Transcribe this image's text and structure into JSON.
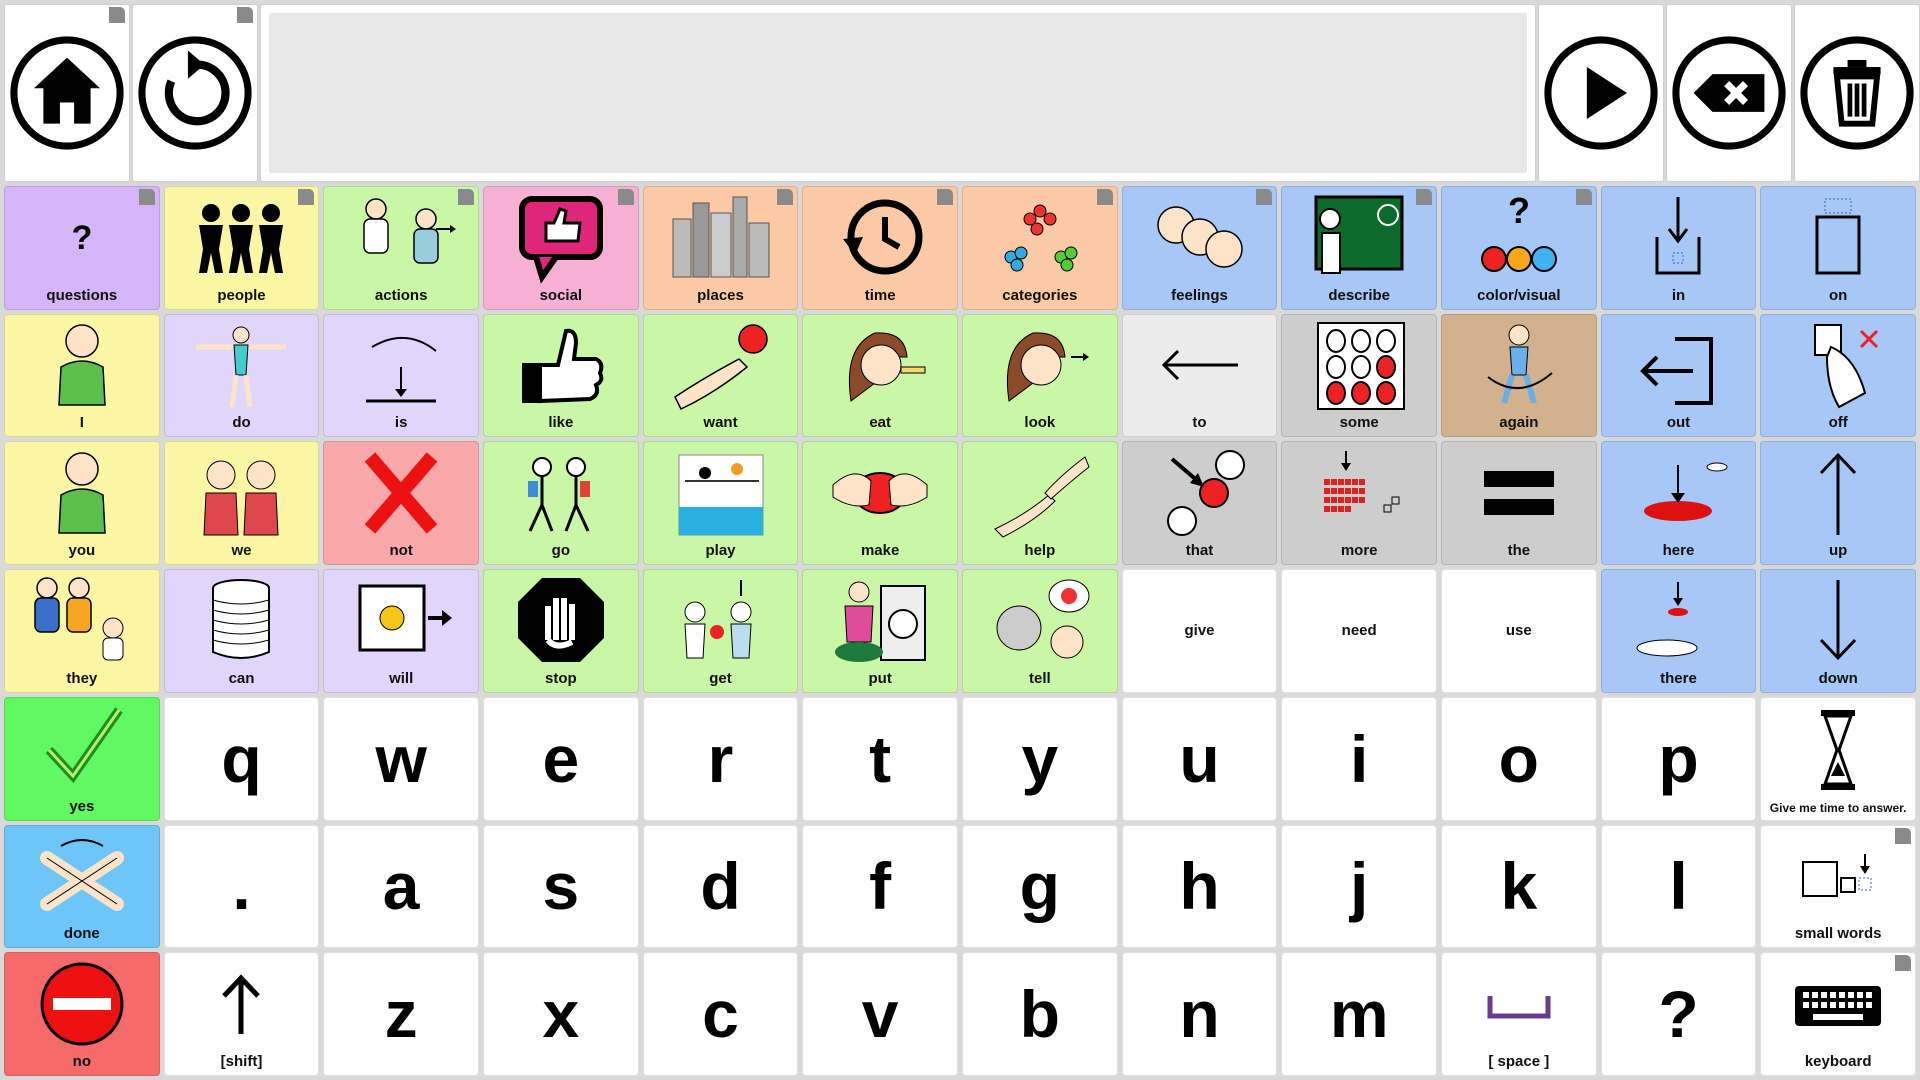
{
  "toolbar": {
    "home_icon": "home-icon",
    "undo_icon": "undo-icon",
    "message": "",
    "speak_icon": "play-icon",
    "backspace_icon": "backspace-icon",
    "clear_icon": "trash-icon"
  },
  "rows": [
    [
      {
        "label": "questions",
        "color": "purple",
        "icon": "question-icon"
      },
      {
        "label": "people",
        "color": "yellow",
        "icon": "people-icon"
      },
      {
        "label": "actions",
        "color": "lgreen",
        "icon": "actions-icon"
      },
      {
        "label": "social",
        "color": "pink",
        "icon": "social-icon"
      },
      {
        "label": "places",
        "color": "peach",
        "icon": "places-icon"
      },
      {
        "label": "time",
        "color": "peach",
        "icon": "clock-icon"
      },
      {
        "label": "categories",
        "color": "peach",
        "icon": "categories-icon"
      },
      {
        "label": "feelings",
        "color": "blue",
        "icon": "feelings-icon"
      },
      {
        "label": "describe",
        "color": "blue",
        "icon": "describe-icon"
      },
      {
        "label": "color/visual",
        "color": "blue",
        "icon": "color-icon"
      },
      {
        "label": "in",
        "color": "blue",
        "icon": "in-icon"
      },
      {
        "label": "on",
        "color": "blue",
        "icon": "on-icon"
      }
    ],
    [
      {
        "label": "I",
        "color": "yellow",
        "icon": "person-icon"
      },
      {
        "label": "do",
        "color": "lav",
        "icon": "do-icon"
      },
      {
        "label": "is",
        "color": "lav",
        "icon": "is-icon"
      },
      {
        "label": "like",
        "color": "lgreen",
        "icon": "thumbs-up-icon"
      },
      {
        "label": "want",
        "color": "lgreen",
        "icon": "want-icon"
      },
      {
        "label": "eat",
        "color": "lgreen",
        "icon": "eat-icon"
      },
      {
        "label": "look",
        "color": "lgreen",
        "icon": "look-icon"
      },
      {
        "label": "to",
        "color": "lgray",
        "icon": "arrow-left-icon"
      },
      {
        "label": "some",
        "color": "gray",
        "icon": "some-icon"
      },
      {
        "label": "again",
        "color": "tan",
        "icon": "again-icon"
      },
      {
        "label": "out",
        "color": "blue",
        "icon": "out-icon"
      },
      {
        "label": "off",
        "color": "blue",
        "icon": "off-icon"
      }
    ],
    [
      {
        "label": "you",
        "color": "yellow",
        "icon": "person-icon"
      },
      {
        "label": "we",
        "color": "yellow",
        "icon": "we-icon"
      },
      {
        "label": "not",
        "color": "red",
        "icon": "cross-icon"
      },
      {
        "label": "go",
        "color": "lgreen",
        "icon": "go-icon"
      },
      {
        "label": "play",
        "color": "lgreen",
        "icon": "play-sport-icon"
      },
      {
        "label": "make",
        "color": "lgreen",
        "icon": "make-icon"
      },
      {
        "label": "help",
        "color": "lgreen",
        "icon": "help-icon"
      },
      {
        "label": "that",
        "color": "gray",
        "icon": "that-icon"
      },
      {
        "label": "more",
        "color": "gray",
        "icon": "more-icon"
      },
      {
        "label": "the",
        "color": "gray",
        "icon": "equals-icon"
      },
      {
        "label": "here",
        "color": "blue",
        "icon": "here-icon"
      },
      {
        "label": "up",
        "color": "blue",
        "icon": "arrow-up-icon"
      }
    ],
    [
      {
        "label": "they",
        "color": "yellow",
        "icon": "they-icon"
      },
      {
        "label": "can",
        "color": "lav",
        "icon": "can-icon"
      },
      {
        "label": "will",
        "color": "lav",
        "icon": "will-icon"
      },
      {
        "label": "stop",
        "color": "lgreen",
        "icon": "stop-icon"
      },
      {
        "label": "get",
        "color": "lgreen",
        "icon": "get-icon"
      },
      {
        "label": "put",
        "color": "lgreen",
        "icon": "put-icon"
      },
      {
        "label": "tell",
        "color": "lgreen",
        "icon": "tell-icon"
      },
      {
        "label": "give",
        "color": "white",
        "icon": ""
      },
      {
        "label": "need",
        "color": "white",
        "icon": ""
      },
      {
        "label": "use",
        "color": "white",
        "icon": ""
      },
      {
        "label": "there",
        "color": "blue",
        "icon": "there-icon"
      },
      {
        "label": "down",
        "color": "blue",
        "icon": "arrow-down-icon"
      }
    ],
    [
      {
        "label": "yes",
        "color": "green",
        "icon": "check-icon"
      },
      {
        "letter": "q"
      },
      {
        "letter": "w"
      },
      {
        "letter": "e"
      },
      {
        "letter": "r"
      },
      {
        "letter": "t"
      },
      {
        "letter": "y"
      },
      {
        "letter": "u"
      },
      {
        "letter": "i"
      },
      {
        "letter": "o"
      },
      {
        "letter": "p"
      },
      {
        "label": "Give me time to answer.",
        "color": "white",
        "icon": "hourglass-icon"
      }
    ],
    [
      {
        "label": "done",
        "color": "sky",
        "icon": "done-icon"
      },
      {
        "letter": "."
      },
      {
        "letter": "a"
      },
      {
        "letter": "s"
      },
      {
        "letter": "d"
      },
      {
        "letter": "f"
      },
      {
        "letter": "g"
      },
      {
        "letter": "h"
      },
      {
        "letter": "j"
      },
      {
        "letter": "k"
      },
      {
        "letter": "l"
      },
      {
        "label": "small words",
        "color": "white",
        "icon": "small-words-icon"
      }
    ],
    [
      {
        "label": "no",
        "color": "coral",
        "icon": "no-entry-icon"
      },
      {
        "label": "[shift]",
        "color": "white",
        "icon": "shift-icon"
      },
      {
        "letter": "z"
      },
      {
        "letter": "x"
      },
      {
        "letter": "c"
      },
      {
        "letter": "v"
      },
      {
        "letter": "b"
      },
      {
        "letter": "n"
      },
      {
        "letter": "m"
      },
      {
        "label": "[ space ]",
        "color": "white",
        "icon": "space-icon"
      },
      {
        "letter": "?"
      },
      {
        "label": "keyboard",
        "color": "white",
        "icon": "keyboard-icon"
      }
    ]
  ],
  "folders": [
    "questions",
    "people",
    "actions",
    "social",
    "places",
    "time",
    "categories",
    "feelings",
    "describe",
    "color/visual",
    "small words",
    "keyboard"
  ]
}
